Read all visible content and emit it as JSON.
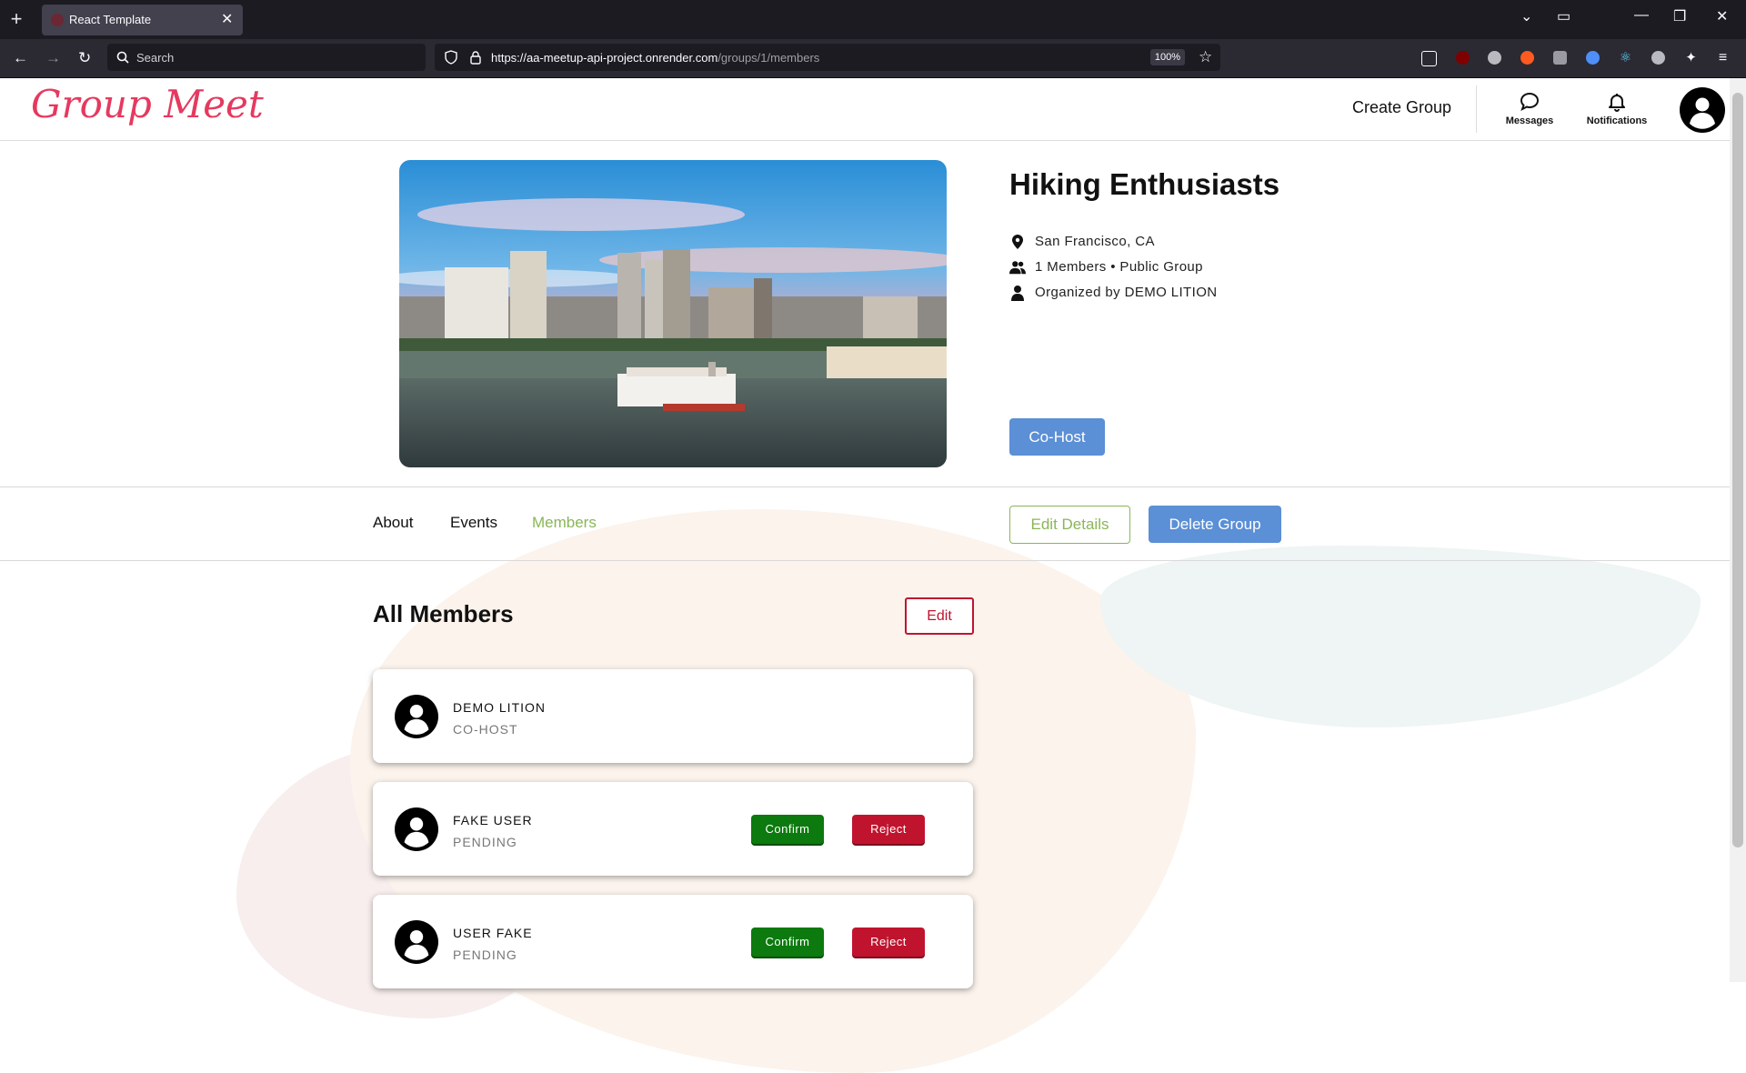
{
  "browser": {
    "tab_title": "React Template",
    "search_placeholder": "Search",
    "url_host": "https://aa-meetup-api-project.onrender.com",
    "url_path": "/groups/1/members",
    "zoom": "100%"
  },
  "header": {
    "logo": "Group Meet",
    "create_group": "Create Group",
    "messages": "Messages",
    "notifications": "Notifications"
  },
  "group": {
    "name": "Hiking Enthusiasts",
    "location": "San Francisco, CA",
    "members_info": "1 Members • Public Group",
    "organizer": "Organized by DEMO LITION",
    "role_button": "Co-Host"
  },
  "tabs": [
    {
      "label": "About",
      "active": false
    },
    {
      "label": "Events",
      "active": false
    },
    {
      "label": "Members",
      "active": true
    }
  ],
  "actions": {
    "edit_details": "Edit Details",
    "delete_group": "Delete Group"
  },
  "members_section": {
    "title": "All Members",
    "edit_label": "Edit",
    "members": [
      {
        "name": "DEMO LITION",
        "role": "CO-HOST"
      },
      {
        "name": "FAKE USER",
        "role": "PENDING",
        "confirm": "Confirm",
        "reject": "Reject"
      },
      {
        "name": "USER FAKE",
        "role": "PENDING",
        "confirm": "Confirm",
        "reject": "Reject"
      }
    ]
  },
  "colors": {
    "brand": "#e6395f",
    "primary": "#5b8fd6",
    "active_tab": "#8ab657",
    "danger": "#c0142e",
    "success": "#0c7a0e"
  }
}
